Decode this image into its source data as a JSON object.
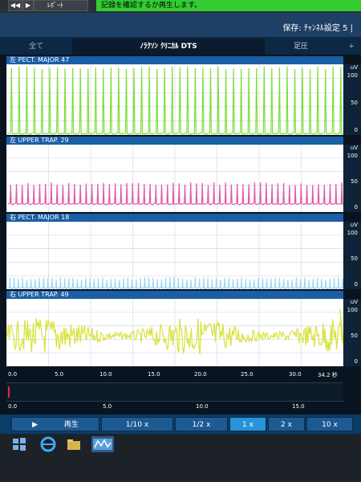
{
  "toolbar": {
    "rewind_glyph": "◀◀",
    "play_glyph": "▶",
    "report_label": "ﾚﾎﾟｰﾄ",
    "message": "記録を確認するか再生します。"
  },
  "settings": {
    "label": "保存: ﾁｬﾝﾈﾙ設定 5 |"
  },
  "tabs": {
    "all": "全て",
    "title": "ﾉﾗｸｿﾝ ｸﾘﾆｶﾙ DTS",
    "foot": "足圧",
    "plus": "+"
  },
  "channels": [
    {
      "label": "左 PECT. MAJOR  47",
      "color": "#7ddf3a",
      "ticks": [
        "uV",
        "100",
        "50",
        "0"
      ]
    },
    {
      "label": "左 UPPER TRAP.  29",
      "color": "#e05aa3",
      "ticks": [
        "uV",
        "100",
        "50",
        "0"
      ]
    },
    {
      "label": "右 PECT. MAJOR  18",
      "color": "#9ad7f0",
      "ticks": [
        "uV",
        "100",
        "50",
        "0"
      ]
    },
    {
      "label": "右 UPPER TRAP.  49",
      "color": "#d8e23a",
      "ticks": [
        "uV",
        "100",
        "50",
        "0"
      ]
    }
  ],
  "time_axis_main": {
    "ticks": [
      "0.0",
      "5.0",
      "10.0",
      "15.0",
      "20.0",
      "25.0",
      "30.0",
      "34.2 秒"
    ]
  },
  "time_axis_overview": {
    "ticks": [
      "0.0",
      "5.0",
      "10.0",
      "15.0"
    ]
  },
  "playback": {
    "play_glyph": "▶",
    "play_label": "再生",
    "speeds": [
      "1/10 x",
      "1/2 x",
      "1 x",
      "2 x",
      "10 x"
    ],
    "active_speed": "1 x"
  },
  "taskbar": {
    "icons": [
      "windows-start-icon",
      "ie-icon",
      "folder-icon",
      "noraxon-app-icon"
    ]
  }
}
